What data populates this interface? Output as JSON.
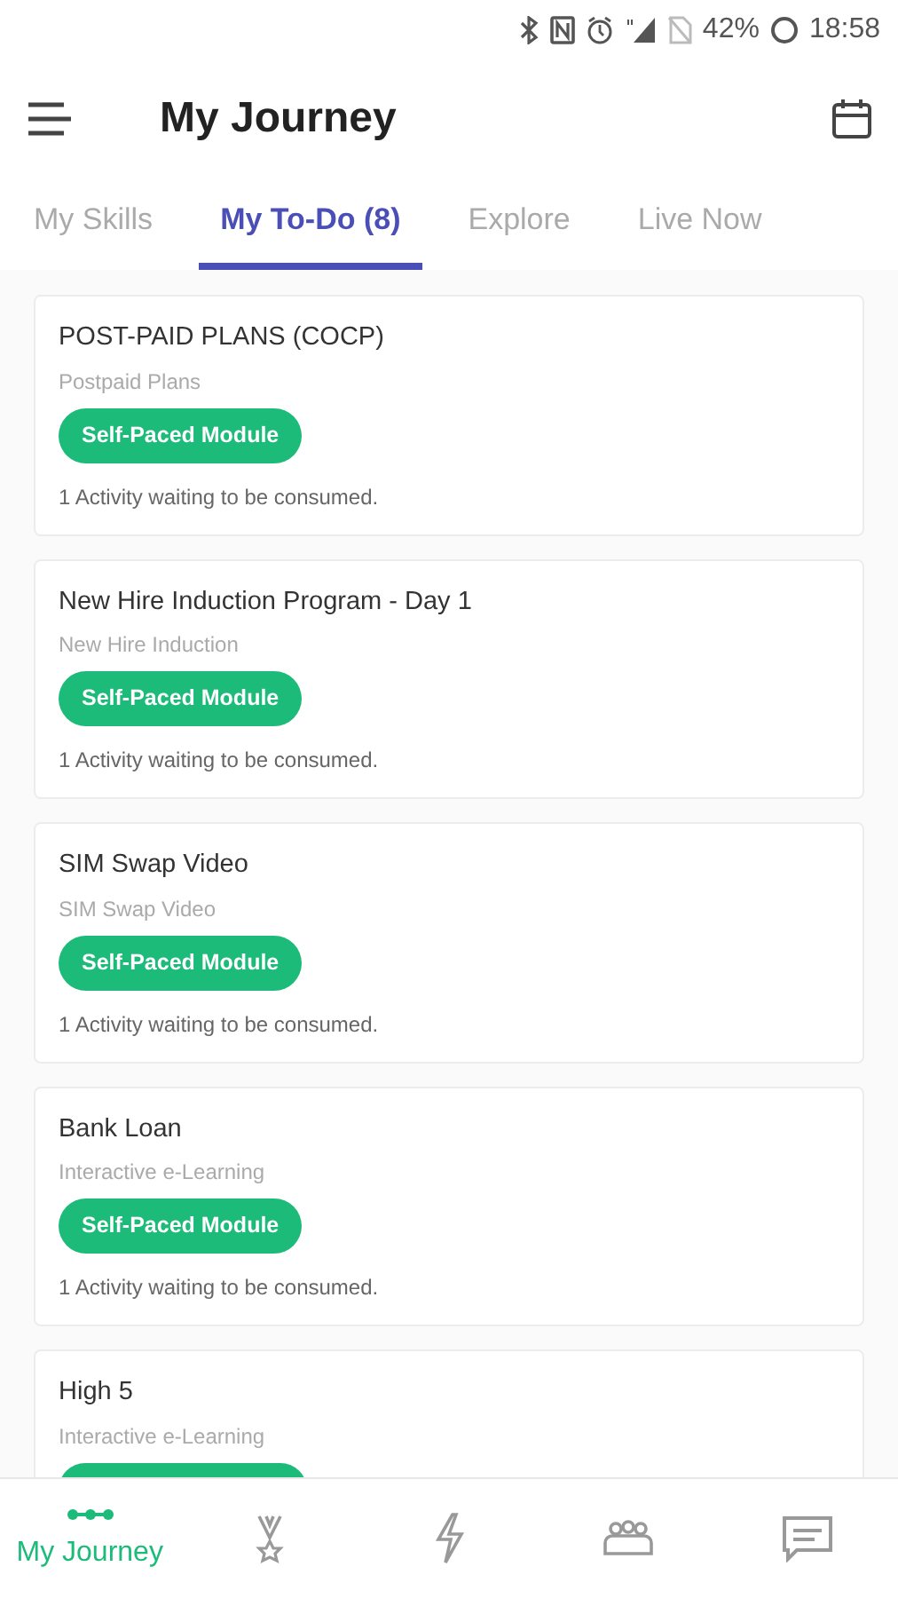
{
  "status_bar": {
    "battery": "42%",
    "time": "18:58"
  },
  "header": {
    "title": "My Journey"
  },
  "tabs": [
    {
      "label": "My Skills",
      "selected": false
    },
    {
      "label": "My To-Do (8)",
      "selected": true
    },
    {
      "label": "Explore",
      "selected": false
    },
    {
      "label": "Live Now",
      "selected": false
    }
  ],
  "cards": [
    {
      "title": "POST-PAID PLANS (COCP)",
      "subtitle": "Postpaid Plans",
      "tag": "Self-Paced Module",
      "note": "1 Activity waiting to be consumed."
    },
    {
      "title": "New Hire Induction Program - Day 1",
      "subtitle": "New Hire Induction",
      "tag": "Self-Paced Module",
      "note": "1 Activity waiting to be consumed."
    },
    {
      "title": "SIM Swap Video",
      "subtitle": "SIM Swap Video",
      "tag": "Self-Paced Module",
      "note": "1 Activity waiting to be consumed."
    },
    {
      "title": "Bank Loan",
      "subtitle": "Interactive e-Learning",
      "tag": "Self-Paced Module",
      "note": "1 Activity waiting to be consumed."
    },
    {
      "title": "High 5",
      "subtitle": "Interactive e-Learning"
    }
  ],
  "bottom_nav": [
    {
      "label": "My Journey",
      "selected": true
    },
    {
      "selected": false
    },
    {
      "selected": false
    },
    {
      "selected": false
    },
    {
      "selected": false
    }
  ]
}
